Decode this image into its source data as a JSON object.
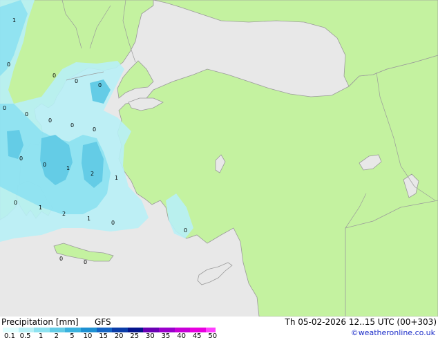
{
  "map": {
    "colors": {
      "sea": "#e8e8e8",
      "land": "#c4f2a0",
      "border": "#9a9a9a",
      "precip_light": "#b8f0f6",
      "precip_mid": "#8ee2f0",
      "precip_heavy": "#64cce6"
    },
    "point_labels": [
      "1",
      "0",
      "0",
      "0",
      "0",
      "0",
      "0",
      "0",
      "0",
      "0",
      "0",
      "0",
      "1",
      "2",
      "1",
      "0",
      "1",
      "1",
      "2",
      "1",
      "0",
      "0",
      "0",
      "0"
    ]
  },
  "footer": {
    "title": "Precipitation [mm]",
    "model": "GFS",
    "datetime": "Th 05-02-2026 12..15 UTC (00+303)",
    "credit": "©weatheronline.co.uk",
    "scale": {
      "ticks": [
        "0.1",
        "0.5",
        "1",
        "2",
        "5",
        "10",
        "15",
        "20",
        "25",
        "30",
        "35",
        "40",
        "45",
        "50"
      ],
      "colors": [
        "#e0ffff",
        "#b8f0f6",
        "#8ee2f0",
        "#64cce6",
        "#3ab2de",
        "#1e90d2",
        "#1464c4",
        "#0a3ca8",
        "#04148c",
        "#6a00b4",
        "#9a00cc",
        "#c800d8",
        "#e800e0",
        "#ff40ff"
      ]
    }
  }
}
